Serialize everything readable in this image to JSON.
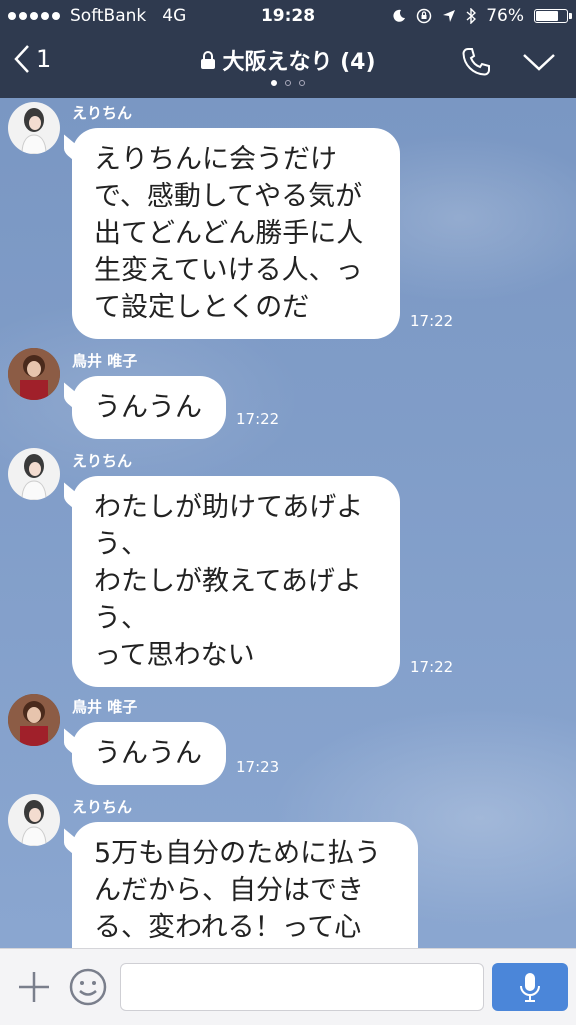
{
  "status_bar": {
    "carrier": "SoftBank",
    "network": "4G",
    "time": "19:28",
    "battery": "76%",
    "battery_level": 0.76
  },
  "header": {
    "back_count": "1",
    "title": "大阪えなり (4)",
    "page_count": 3,
    "active_page": 0
  },
  "messages": [
    {
      "sender": "えりちん",
      "text": "えりちんに会うだけ\nで、感動してやる気が\n出てどんどん勝手に人\n生変えていける人、っ\nて設定しとくのだ",
      "time": "17:22"
    },
    {
      "sender": "鳥井 唯子",
      "text": "うんうん",
      "time": "17:22"
    },
    {
      "sender": "えりちん",
      "text": "わたしが助けてあげよ\nう、\nわたしが教えてあげよ\nう、\nって思わない",
      "time": "17:22"
    },
    {
      "sender": "鳥井 唯子",
      "text": "うんうん",
      "time": "17:23"
    },
    {
      "sender": "えりちん",
      "text": "5万も自分のために払う\nんだから、自分はでき\nる、変われる！って心",
      "time": ""
    }
  ],
  "input": {
    "placeholder": ""
  },
  "colors": {
    "header_bg": "#2f3a4f",
    "chat_bg": "#7b99c7",
    "mic_button": "#4b86d9"
  },
  "icons": [
    "back-chevron-icon",
    "lock-icon",
    "phone-icon",
    "chevron-down-icon",
    "plus-icon",
    "emoji-icon",
    "microphone-icon",
    "moon-icon",
    "location-arrow-icon",
    "bluetooth-icon"
  ]
}
